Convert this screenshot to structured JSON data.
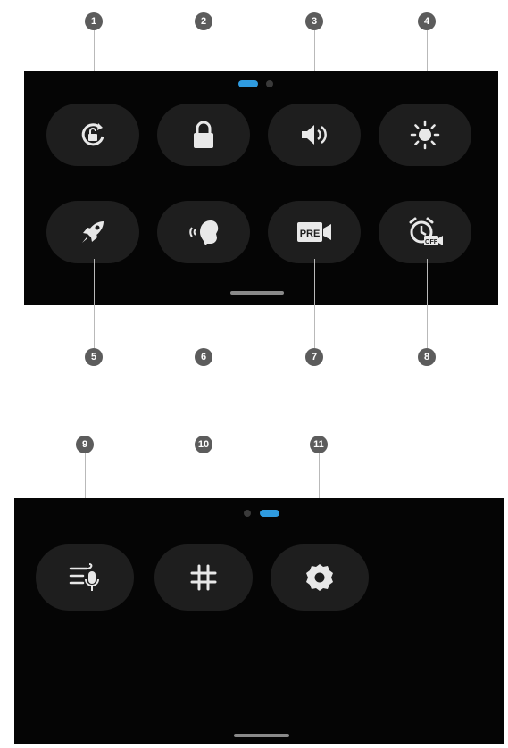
{
  "panel1": {
    "buttons": [
      {
        "id": 1,
        "icon": "rotation-lock-icon"
      },
      {
        "id": 2,
        "icon": "lock-icon"
      },
      {
        "id": 3,
        "icon": "volume-icon"
      },
      {
        "id": 4,
        "icon": "brightness-icon"
      },
      {
        "id": 5,
        "icon": "rocket-icon"
      },
      {
        "id": 6,
        "icon": "voice-control-icon"
      },
      {
        "id": 7,
        "icon": "pre-record-icon",
        "badge": "PRE"
      },
      {
        "id": 8,
        "icon": "alarm-off-icon",
        "badge": "OFF"
      }
    ],
    "page_indicator": {
      "active_page": 1,
      "pages": 2
    }
  },
  "panel2": {
    "buttons": [
      {
        "id": 9,
        "icon": "voice-commands-icon"
      },
      {
        "id": 10,
        "icon": "grid-icon"
      },
      {
        "id": 11,
        "icon": "settings-gear-icon"
      }
    ],
    "page_indicator": {
      "active_page": 2,
      "pages": 2
    }
  },
  "callouts": [
    "1",
    "2",
    "3",
    "4",
    "5",
    "6",
    "7",
    "8",
    "9",
    "10",
    "11"
  ],
  "colors": {
    "screen_bg": "#050505",
    "button_bg": "#1e1e1e",
    "accent": "#2f9be0",
    "callout_bg": "#5c5c5c"
  }
}
